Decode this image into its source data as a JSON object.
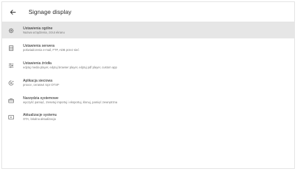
{
  "appbar": {
    "back_icon": "arrow-left-icon",
    "title": "Signage display"
  },
  "items": [
    {
      "icon": "gear-icon",
      "label": "Ustawienia ogólne",
      "sub": "Nazwa urządzenia, zrzut ekranu"
    },
    {
      "icon": "server-icon",
      "label": "Ustawienia serwera",
      "sub": "poświadczenia e-mail, FTP, ADB przez sieć"
    },
    {
      "icon": "sliders-icon",
      "label": "Ustawienia źródła",
      "sub": "edytuj media player, edytuj browser player, edytuj pdf player, custom app"
    },
    {
      "icon": "network-app-icon",
      "label": "Aplikacja sieciowa",
      "sub": "proxce, cerasw4 ropr OTSP"
    },
    {
      "icon": "toolbox-icon",
      "label": "Narzędzia systemowe",
      "sub": "wyczyść pamięć, zresetuj importuj i eksportuj, klonuj, pamięć zewnętrzna"
    },
    {
      "icon": "system-update-icon",
      "label": "Aktualizacje systemu",
      "sub": "OTA, lokalna aktualizacja"
    }
  ],
  "colors": {
    "selected_bg": "#e6e6e6",
    "text_primary": "#222222",
    "text_secondary": "#777777",
    "icon": "#666666"
  }
}
